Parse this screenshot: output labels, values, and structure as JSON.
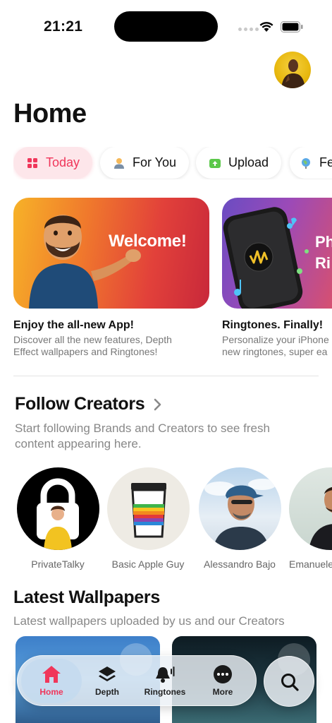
{
  "status": {
    "time": "21:21"
  },
  "page_title": "Home",
  "tabs": [
    {
      "label": "Today",
      "icon": "grid-icon",
      "active": true
    },
    {
      "label": "For You",
      "icon": "person-icon"
    },
    {
      "label": "Upload",
      "icon": "upload-icon"
    },
    {
      "label": "Fe",
      "icon": "globe-icon"
    }
  ],
  "features": [
    {
      "art_text": "Welcome!",
      "title": "Enjoy the all-new App!",
      "desc_line1": "Discover all the new features, Depth",
      "desc_line2": "Effect wallpapers and Ringtones!"
    },
    {
      "art_text": "Ph",
      "art_text2": "Ri",
      "title": "Ringtones. Finally!",
      "desc_line1": "Personalize your iPhone",
      "desc_line2": "new ringtones, super ea"
    }
  ],
  "follow": {
    "title": "Follow Creators",
    "desc_line1": "Start following Brands and Creators to see fresh",
    "desc_line2": "content appearing here."
  },
  "creators": [
    {
      "name": "PrivateTalky"
    },
    {
      "name": "Basic Apple Guy"
    },
    {
      "name": "Alessandro Bajo"
    },
    {
      "name": "Emanuele"
    }
  ],
  "latest": {
    "title": "Latest Wallpapers",
    "desc": "Latest wallpapers uploaded by us and our Creators"
  },
  "tabbar": [
    {
      "label": "Home",
      "icon": "house-icon",
      "active": true
    },
    {
      "label": "Depth",
      "icon": "layers-icon"
    },
    {
      "label": "Ringtones",
      "icon": "bell-icon"
    },
    {
      "label": "More",
      "icon": "ellipsis-icon"
    }
  ],
  "colors": {
    "accent": "#f0365a",
    "muted_text": "#888888"
  }
}
